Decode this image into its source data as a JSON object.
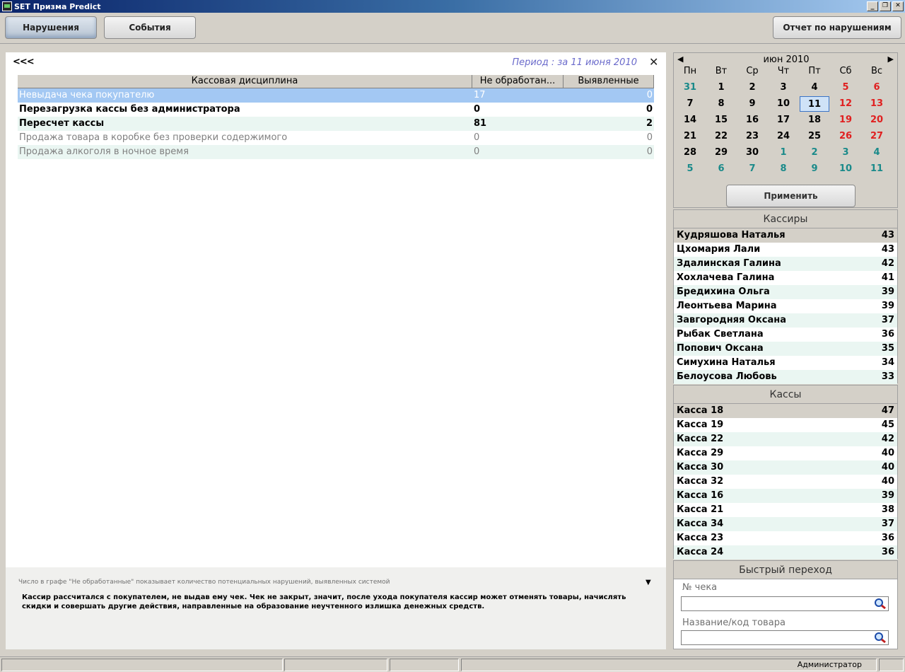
{
  "window": {
    "title": "SET Призма Predict",
    "minimize": "_",
    "restore": "❐",
    "close": "✕"
  },
  "toolbar": {
    "violations_label": "Нарушения",
    "events_label": "События",
    "report_label": "Отчет по нарушениям"
  },
  "main": {
    "back_label": "<<<",
    "period": "Период : за 11 июня 2010",
    "close_label": "✕",
    "columns": [
      "Кассовая дисциплина",
      "Не обработан...",
      "Выявленные"
    ],
    "rows": [
      {
        "name": "Невыдача чека покупателю",
        "unprocessed": "17",
        "found": "0"
      },
      {
        "name": "Перезагрузка кассы без администратора",
        "unprocessed": "0",
        "found": "0"
      },
      {
        "name": "Пересчет кассы",
        "unprocessed": "81",
        "found": "2"
      },
      {
        "name": "Продажа товара в коробке без проверки содержимого",
        "unprocessed": "0",
        "found": "0"
      },
      {
        "name": "Продажа алкоголя в ночное время",
        "unprocessed": "0",
        "found": "0"
      }
    ],
    "hint": "Число в графе \"Не обработанные\" показывает количество потенциальных нарушений, выявленных системой",
    "description": "Кассир рассчитался с покупателем, не выдав ему чек. Чек не закрыт, значит, после ухода покупателя кассир может отменять товары, начислять скидки и совершать другие действия, направленные на образование неучтенного излишка денежных средств."
  },
  "calendar": {
    "month": "июн 2010",
    "prev": "◀",
    "next": "▶",
    "weekdays": [
      "Пн",
      "Вт",
      "Ср",
      "Чт",
      "Пт",
      "Сб",
      "Вс"
    ],
    "weeks": [
      [
        "31",
        "1",
        "2",
        "3",
        "4",
        "5",
        "6"
      ],
      [
        "7",
        "8",
        "9",
        "10",
        "11",
        "12",
        "13"
      ],
      [
        "14",
        "15",
        "16",
        "17",
        "18",
        "19",
        "20"
      ],
      [
        "21",
        "22",
        "23",
        "24",
        "25",
        "26",
        "27"
      ],
      [
        "28",
        "29",
        "30",
        "1",
        "2",
        "3",
        "4"
      ],
      [
        "5",
        "6",
        "7",
        "8",
        "9",
        "10",
        "11"
      ]
    ],
    "selected": "11",
    "apply_label": "Применить",
    "colors": {
      "weekend": "#e02020",
      "other_month": "#1a8a8a"
    }
  },
  "cashiers": {
    "title": "Кассиры",
    "items": [
      {
        "name": "Кудряшова Наталья",
        "count": "43"
      },
      {
        "name": "Цхомария Лали",
        "count": "43"
      },
      {
        "name": "Здалинская Галина",
        "count": "42"
      },
      {
        "name": "Хохлачева Галина",
        "count": "41"
      },
      {
        "name": "Бредихина Ольга",
        "count": "39"
      },
      {
        "name": "Леонтьева Марина",
        "count": "39"
      },
      {
        "name": "Завгородняя Оксана",
        "count": "37"
      },
      {
        "name": "Рыбак Светлана",
        "count": "36"
      },
      {
        "name": "Попович Оксана",
        "count": "35"
      },
      {
        "name": "Симухина Наталья",
        "count": "34"
      },
      {
        "name": "Белоусова Любовь",
        "count": "33"
      }
    ]
  },
  "registers": {
    "title": "Кассы",
    "items": [
      {
        "name": "Касса 18",
        "count": "47"
      },
      {
        "name": "Касса 19",
        "count": "45"
      },
      {
        "name": "Касса 22",
        "count": "42"
      },
      {
        "name": "Касса 29",
        "count": "40"
      },
      {
        "name": "Касса 30",
        "count": "40"
      },
      {
        "name": "Касса 32",
        "count": "40"
      },
      {
        "name": "Касса 16",
        "count": "39"
      },
      {
        "name": "Касса 21",
        "count": "38"
      },
      {
        "name": "Касса 34",
        "count": "37"
      },
      {
        "name": "Касса 23",
        "count": "36"
      },
      {
        "name": "Касса 24",
        "count": "36"
      }
    ]
  },
  "quick": {
    "title": "Быстрый переход",
    "receipt_label": "№ чека",
    "product_label": "Название/код товара",
    "search_icon": "search-icon"
  },
  "status": {
    "user": "Администратор"
  }
}
